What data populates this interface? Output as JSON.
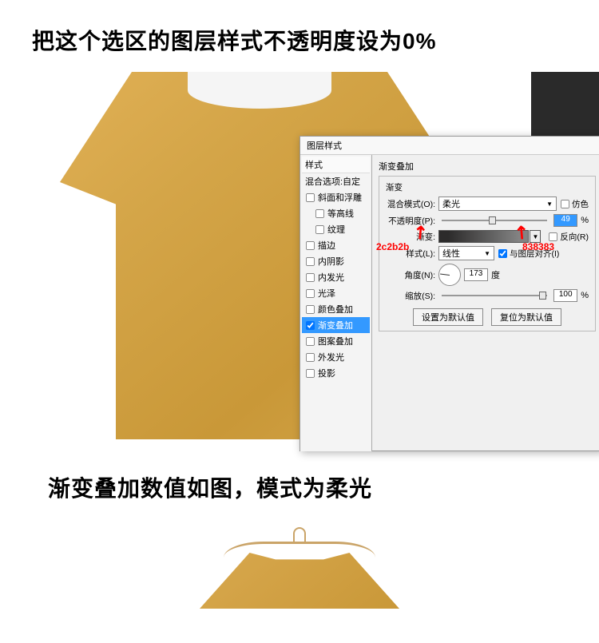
{
  "caption_top": "把这个选区的图层样式不透明度设为0%",
  "caption_bottom": "渐变叠加数值如图，模式为柔光",
  "dialog": {
    "title": "图层样式",
    "left_header": "样式",
    "blend_options": "混合选项:自定",
    "styles": [
      "斜面和浮雕",
      "等高线",
      "纹理",
      "描边",
      "内阴影",
      "内发光",
      "光泽",
      "颜色叠加",
      "渐变叠加",
      "图案叠加",
      "外发光",
      "投影"
    ],
    "selected_style_index": 8,
    "right_header": "渐变叠加",
    "fieldset_label": "渐变",
    "blend_mode_label": "混合模式(O):",
    "blend_mode_value": "柔光",
    "dither_label": "仿色",
    "opacity_label": "不透明度(P):",
    "opacity_value": "49",
    "opacity_unit": "%",
    "gradient_label": "渐变:",
    "reverse_label": "反向(R)",
    "style_label": "样式(L):",
    "style_value": "线性",
    "align_label": "与图层对齐(I)",
    "angle_label": "角度(N):",
    "angle_value": "173",
    "angle_unit": "度",
    "scale_label": "缩放(S):",
    "scale_value": "100",
    "scale_unit": "%",
    "set_default": "设置为默认值",
    "reset_default": "复位为默认值"
  },
  "annotations": {
    "left_hex": "2c2b2b",
    "right_hex": "838383"
  }
}
